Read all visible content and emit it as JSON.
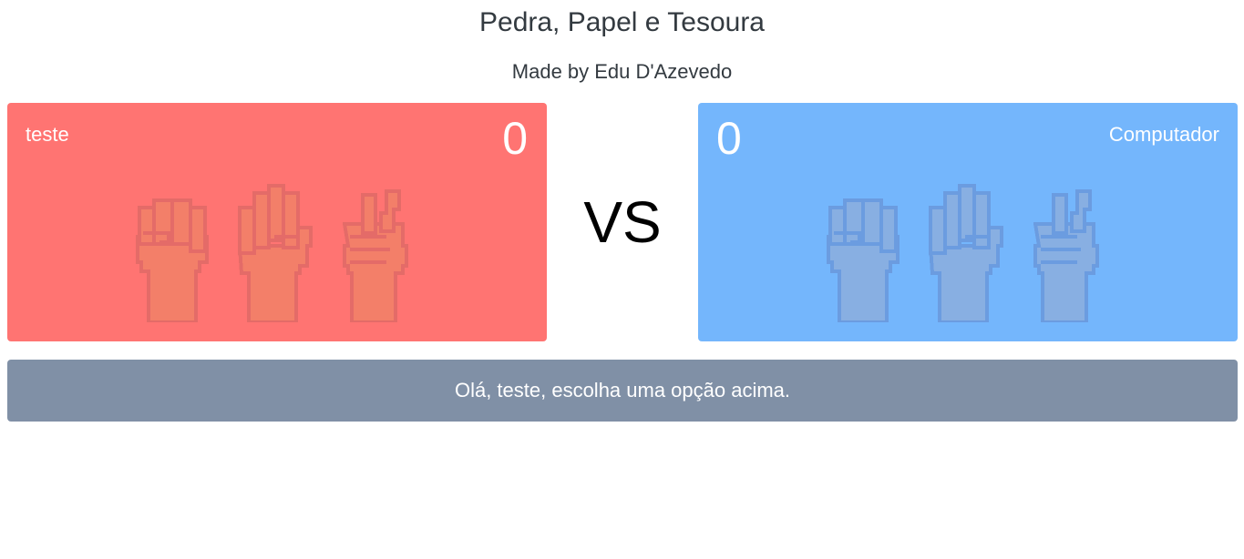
{
  "header": {
    "title": "Pedra, Papel e Tesoura",
    "subtitle": "Made by Edu D'Azevedo"
  },
  "player": {
    "name": "teste",
    "score": "0",
    "panel_color": "#ff7472",
    "hand_fill": "#f28268",
    "hand_outline": "#e06a67",
    "options": [
      {
        "name": "rock",
        "icon": "rock-fist-icon"
      },
      {
        "name": "paper",
        "icon": "paper-hand-icon"
      },
      {
        "name": "scissors",
        "icon": "scissors-hand-icon"
      }
    ]
  },
  "computer": {
    "name": "Computador",
    "score": "0",
    "panel_color": "#74b6fc",
    "hand_fill": "#8caede",
    "hand_outline": "#6a98dc",
    "options": [
      {
        "name": "rock",
        "icon": "rock-fist-icon"
      },
      {
        "name": "paper",
        "icon": "paper-hand-icon"
      },
      {
        "name": "scissors",
        "icon": "scissors-hand-icon"
      }
    ]
  },
  "versus_label": "VS",
  "message": {
    "text": "Olá, teste, escolha uma opção acima.",
    "color": "#8090a6"
  }
}
